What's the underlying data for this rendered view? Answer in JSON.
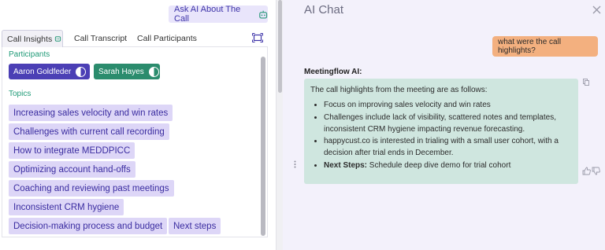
{
  "ask_ai": {
    "label": "Ask AI About The Call",
    "icon": "robot-icon"
  },
  "tabs": [
    {
      "label": "Call Insights",
      "icon": "sparkle-icon",
      "active": true
    },
    {
      "label": "Call Transcript"
    },
    {
      "label": "Call Participants"
    }
  ],
  "expand_icon": "expand-icon",
  "insights": {
    "participants_label": "Participants",
    "participants": [
      {
        "name": "Aaron Goldfeder",
        "color": "#4b3fb5"
      },
      {
        "name": "Sarah Hayes",
        "color": "#2b8c6d"
      }
    ],
    "topics_label": "Topics",
    "topics": [
      "Increasing sales velocity and win rates",
      "Challenges with current call recording",
      "How to integrate MEDDPICC",
      "Optimizing account hand-offs",
      "Coaching and reviewing past meetings",
      "Inconsistent CRM hygiene",
      "Decision-making process and budget",
      "Next steps"
    ]
  },
  "chat": {
    "title": "AI Chat",
    "user_message": "what were the call highlights?",
    "bot_name": "Meetingflow AI:",
    "bot_intro": "The call highlights from the meeting are as follows:",
    "bullets": [
      "Focus on improving sales velocity and win rates",
      "Challenges include lack of visibility, scattered notes and templates, inconsistent CRM hygiene impacting revenue forecasting.",
      "happycust.co is interested in trialing with a small user cohort, with a decision after trial ends in December."
    ],
    "next_steps_label": "Next Steps:",
    "next_steps_text": " Schedule deep dive demo for trial cohort"
  },
  "colors": {
    "accent": "#4b3fb5",
    "topic_bg": "#ddd6f7",
    "user_bubble": "#f3b07f",
    "bot_bubble": "#cfe6df",
    "section_label": "#1f9a77"
  }
}
